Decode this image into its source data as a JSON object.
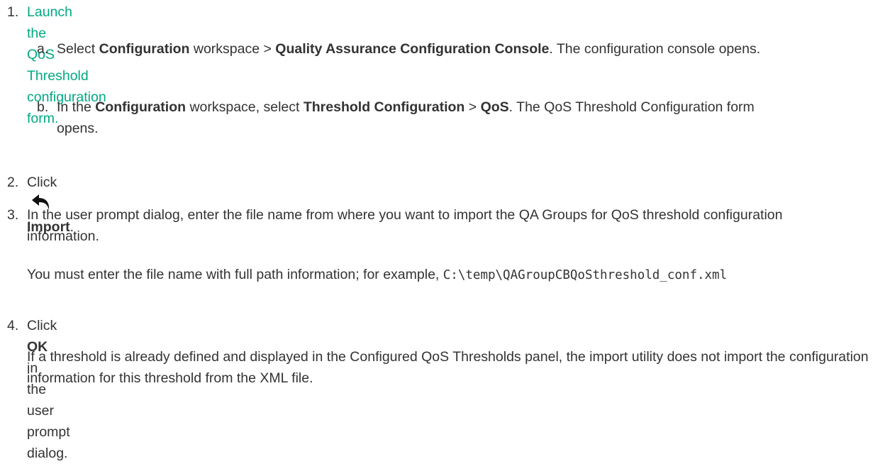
{
  "steps": [
    {
      "num": "1.",
      "link": "Launch the QoS Threshold configuration form."
    },
    {
      "num": "2.",
      "pre": "Click",
      "bold": "Import",
      "post": "."
    },
    {
      "num": "3.",
      "text": "In the user prompt dialog, enter the file name from where you want to import the QA Groups for QoS threshold configuration information.",
      "note_pre": "You must enter the file name with full path information; for example, ",
      "note_code": "C:\\temp\\QAGroupCBQoSthreshold_conf.xml"
    },
    {
      "num": "4.",
      "pre": "Click ",
      "bold": "OK",
      "post": " in the user prompt dialog.",
      "note": "If a threshold is already defined and displayed in the Configured QoS Thresholds panel, the import utility does not import the configuration information for this threshold from the XML file."
    }
  ],
  "substeps": [
    {
      "num": "a.",
      "t1": "Select ",
      "b1": "Configuration",
      "t2": " workspace > ",
      "b2": "Quality Assurance Configuration Console",
      "t3": ". The configuration console opens."
    },
    {
      "num": "b.",
      "t1": "In the ",
      "b1": "Configuration",
      "t2": " workspace, select ",
      "b2": "Threshold Configuration",
      "t3": " > ",
      "b3": "QoS",
      "t4": ". The QoS Threshold Configuration form opens."
    }
  ],
  "icons": {
    "import": "undo-arrow-icon"
  }
}
